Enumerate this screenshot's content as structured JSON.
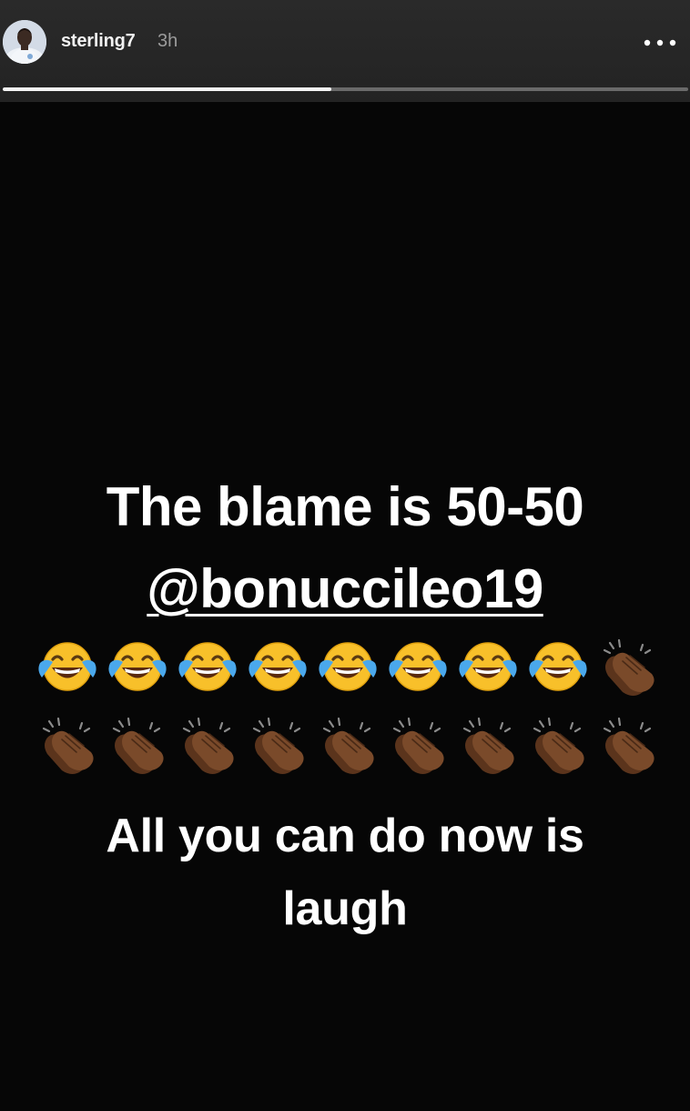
{
  "header": {
    "username": "sterling7",
    "timestamp": "3h",
    "avatar_icon": "profile-photo-avatar",
    "more_icon": "ellipsis-icon",
    "progress_fraction": 0.48
  },
  "story": {
    "line1": "The blame is 50-50",
    "line2": "@bonuccileo19",
    "emoji_row1": [
      "face-with-tears-of-joy",
      "face-with-tears-of-joy",
      "face-with-tears-of-joy",
      "face-with-tears-of-joy",
      "face-with-tears-of-joy",
      "face-with-tears-of-joy",
      "face-with-tears-of-joy",
      "face-with-tears-of-joy",
      "clapping-hands"
    ],
    "emoji_row2": [
      "clapping-hands",
      "clapping-hands",
      "clapping-hands",
      "clapping-hands",
      "clapping-hands",
      "clapping-hands",
      "clapping-hands",
      "clapping-hands",
      "clapping-hands"
    ],
    "line3": "All you can do now is",
    "line4": "laugh"
  },
  "colors": {
    "background": "#060606",
    "text": "#ffffff",
    "emoji_face": "#f8c02a",
    "clap_skin": "#7a4a2a"
  }
}
